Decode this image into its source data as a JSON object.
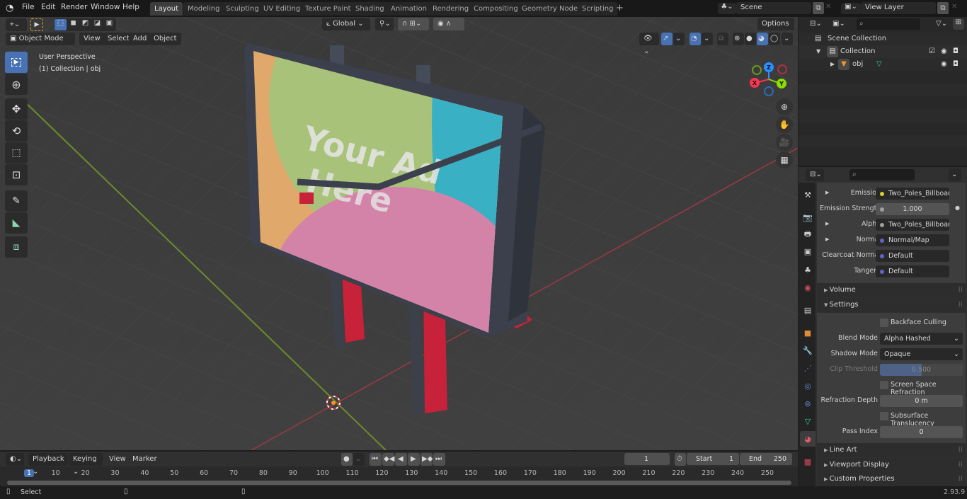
{
  "topbar": {
    "menus": [
      "File",
      "Edit",
      "Render",
      "Window",
      "Help"
    ],
    "workspaces": [
      "Layout",
      "Modeling",
      "Sculpting",
      "UV Editing",
      "Texture Paint",
      "Shading",
      "Animation",
      "Rendering",
      "Compositing",
      "Geometry Nodes",
      "Scripting"
    ],
    "active_workspace": "Layout",
    "add_tab": "+",
    "scene": "Scene",
    "view_layer": "View Layer"
  },
  "viewport": {
    "mode": "Object Mode",
    "menus": [
      "View",
      "Select",
      "Add",
      "Object"
    ],
    "transform_orientation": "Global",
    "options_label": "Options",
    "overlay_title": "User Perspective",
    "overlay_subtitle": "(1) Collection | obj",
    "billboard_text": [
      "Your Ad",
      "Here"
    ],
    "gizmo_axes": {
      "x": "X",
      "y": "Y",
      "z": "Z"
    },
    "colors": {
      "x_axis": "#ff3352",
      "y_axis": "#8bdc00",
      "z_axis": "#2890ff",
      "select_active": "#4772b3"
    },
    "tools": [
      "select-box",
      "cursor",
      "move",
      "rotate",
      "scale",
      "transform",
      "annotate",
      "measure",
      "add-cube"
    ],
    "nav_buttons": [
      "zoom",
      "pan",
      "camera",
      "perspective-toggle"
    ]
  },
  "outliner": {
    "root": "Scene Collection",
    "items": [
      {
        "name": "Collection",
        "type": "collection"
      },
      {
        "name": "obj",
        "type": "object"
      }
    ]
  },
  "properties": {
    "inputs": [
      {
        "label": "Emission",
        "value": "Two_Poles_Billboard...",
        "dot": "#d6d22a",
        "expand": true
      },
      {
        "label": "Emission Strengt",
        "value": "1.000",
        "dot": "#a0a0a0",
        "expand": false,
        "numeric": true
      },
      {
        "label": "Alpha",
        "value": "Two_Poles_Billboard...",
        "dot": "#a0a0a0",
        "expand": true
      },
      {
        "label": "Normal",
        "value": "Normal/Map",
        "dot": "#6363c7",
        "expand": true
      },
      {
        "label": "Clearcoat Normal",
        "value": "Default",
        "dot": "#6363c7",
        "expand": false
      },
      {
        "label": "Tangent",
        "value": "Default",
        "dot": "#6363c7",
        "expand": false
      }
    ],
    "panels": {
      "volume": "Volume",
      "settings": "Settings",
      "line_art": "Line Art",
      "viewport_display": "Viewport Display",
      "custom_properties": "Custom Properties"
    },
    "settings": {
      "backface_culling": {
        "label": "Backface Culling",
        "checked": false
      },
      "blend_mode": {
        "label": "Blend Mode",
        "value": "Alpha Hashed"
      },
      "shadow_mode": {
        "label": "Shadow Mode",
        "value": "Opaque"
      },
      "clip_threshold": {
        "label": "Clip Threshold",
        "value": "0.500",
        "fraction": 0.5
      },
      "screen_space_refraction": {
        "label": "Screen Space Refraction",
        "checked": false
      },
      "refraction_depth": {
        "label": "Refraction Depth",
        "value": "0 m"
      },
      "subsurface_translucency": {
        "label": "Subsurface Translucency",
        "checked": false
      },
      "pass_index": {
        "label": "Pass Index",
        "value": "0"
      }
    }
  },
  "timeline": {
    "menus": [
      "Playback",
      "Keying",
      "View",
      "Marker"
    ],
    "current_frame": "1",
    "start_label": "Start",
    "start": "1",
    "end_label": "End",
    "end": "250",
    "ticks": [
      "1",
      "10",
      "20",
      "30",
      "40",
      "50",
      "60",
      "70",
      "80",
      "90",
      "100",
      "110",
      "120",
      "130",
      "140",
      "150",
      "160",
      "170",
      "180",
      "190",
      "200",
      "210",
      "220",
      "230",
      "240",
      "250"
    ]
  },
  "statusbar": {
    "left_hint": "Select",
    "version": "2.93.9"
  }
}
